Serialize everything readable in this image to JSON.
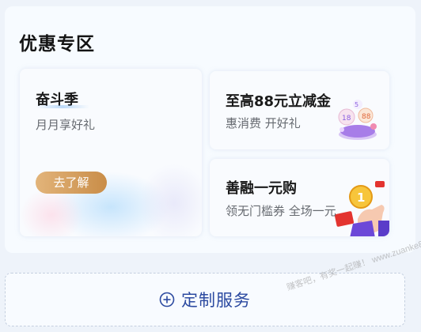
{
  "section": {
    "title": "优惠专区"
  },
  "cards": {
    "left": {
      "title": "奋斗季",
      "subtitle": "月月享好礼",
      "button_label": "去了解"
    },
    "right_top": {
      "title": "至高88元立减金",
      "subtitle": "惠消费  开好礼"
    },
    "right_bottom": {
      "title": "善融一元购",
      "subtitle": "领无门槛券 全场一元"
    }
  },
  "service": {
    "label": "定制服务",
    "icon": "plus-circle-icon"
  },
  "watermark": {
    "text": "赚客吧，有奖一起赚！ www.zuanke8.com"
  },
  "colors": {
    "accent_blue": "#2c4aa0",
    "button_gold": "#d9a45f",
    "deco_purple": "#8a5fe0",
    "deco_red": "#e3342f"
  }
}
